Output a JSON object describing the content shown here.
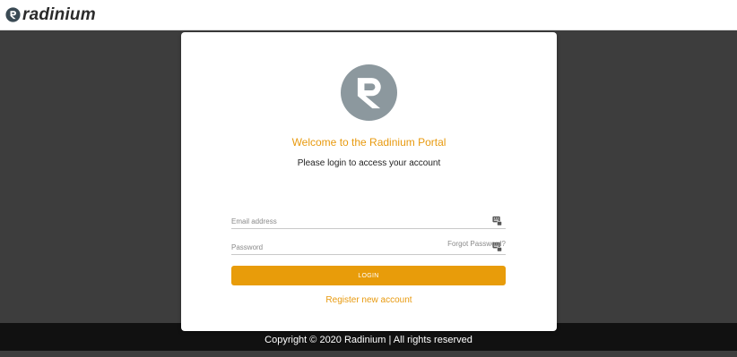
{
  "header": {
    "brand_name": "radinium"
  },
  "login_card": {
    "welcome": "Welcome to the Radinium Portal",
    "subtitle": "Please login to access your account",
    "email": {
      "placeholder": "Email address",
      "value": ""
    },
    "password": {
      "placeholder": "Password",
      "value": ""
    },
    "forgot_label": "Forgot Password?",
    "login_label": "LOGIN",
    "register_label": "Register new account"
  },
  "footer": {
    "text": "Copyright © 2020 Radinium | All rights reserved"
  },
  "icons": {
    "brand": "radinium-logo-icon",
    "card_logo": "radinium-logo-icon",
    "email_field": "keyboard-icon",
    "password_field": "keyboard-icon"
  },
  "colors": {
    "accent": "#e89c0a",
    "logo_grey": "#8c989e",
    "backdrop": "#3d3d3d",
    "footer_bg": "#111111"
  }
}
